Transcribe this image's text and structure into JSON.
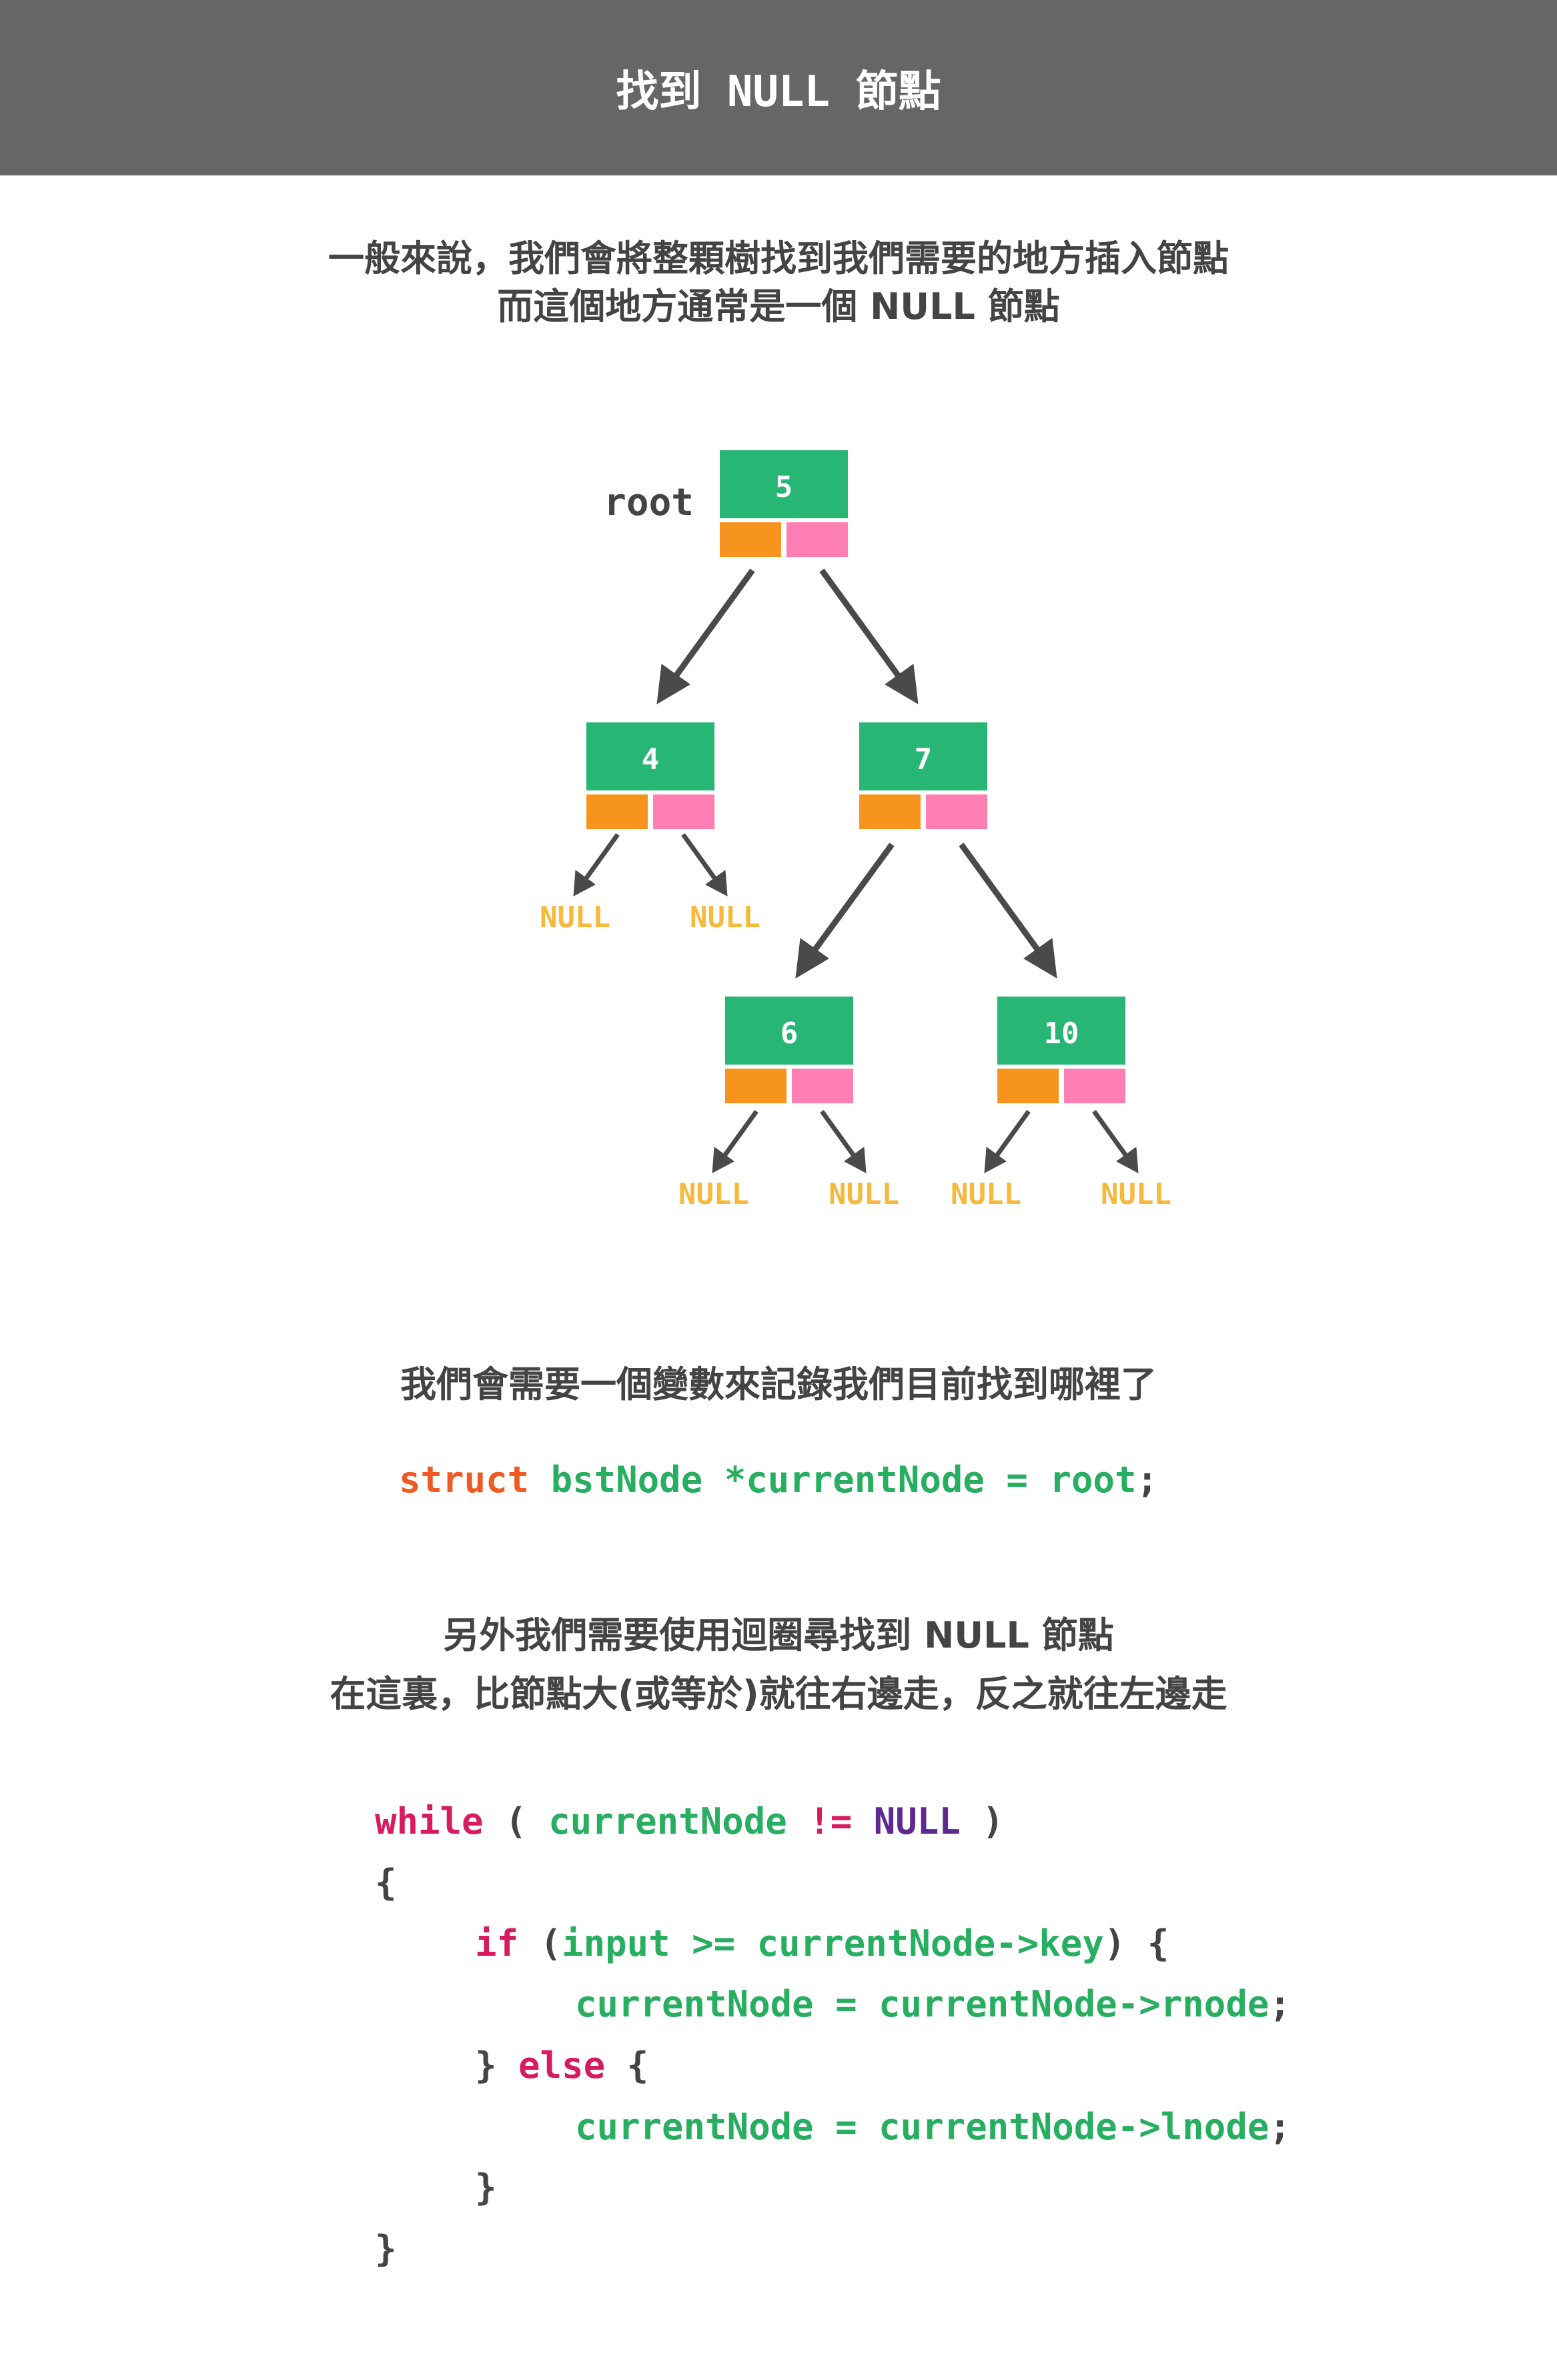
{
  "header": {
    "title": "找到 NULL 節點"
  },
  "intro": {
    "lines": [
      "一般來說，我們會將整顆樹找到我們需要的地方插入節點",
      "而這個地方通常是一個 NULL 節點"
    ]
  },
  "tree": {
    "root_label": "root",
    "null_label": "NULL",
    "nodes": [
      {
        "id": "n5",
        "key": "5"
      },
      {
        "id": "n4",
        "key": "4"
      },
      {
        "id": "n7",
        "key": "7"
      },
      {
        "id": "n6",
        "key": "6"
      },
      {
        "id": "n10",
        "key": "10"
      }
    ],
    "colors": {
      "node_key": "#27b673",
      "left_ptr": "#f7941d",
      "right_ptr": "#ff7eb3",
      "null_text": "#f6b93b",
      "arrow": "#4a4a4a"
    }
  },
  "variable": {
    "intro": "我們會需要一個變數來記錄我們目前找到哪裡了",
    "decl": {
      "keyword": "struct",
      "type": "bstNode",
      "name": "*currentNode",
      "op": "=",
      "value": "root",
      "end": ";"
    }
  },
  "loop": {
    "intro_lines": [
      "另外我們需要使用迴圈尋找到 NULL 節點",
      "在這裏，比節點大(或等於)就往右邊走，反之就往左邊走"
    ],
    "code": {
      "l1": {
        "kw": "while",
        "p1": " ( ",
        "var": "currentNode",
        "op": " != ",
        "null": "NULL",
        "p2": " )"
      },
      "l2": {
        "text": "{"
      },
      "l3": {
        "kw": "if",
        "p1": " (",
        "expr": "input >= currentNode->key",
        "p2": ") {"
      },
      "l4": {
        "expr": "currentNode = currentNode->rnode",
        "end": ";"
      },
      "l5": {
        "p1": "} ",
        "kw": "else",
        "p2": " {"
      },
      "l6": {
        "expr": "currentNode = currentNode->lnode",
        "end": ";"
      },
      "l7": {
        "text": "}"
      },
      "l8": {
        "text": "}"
      }
    }
  }
}
